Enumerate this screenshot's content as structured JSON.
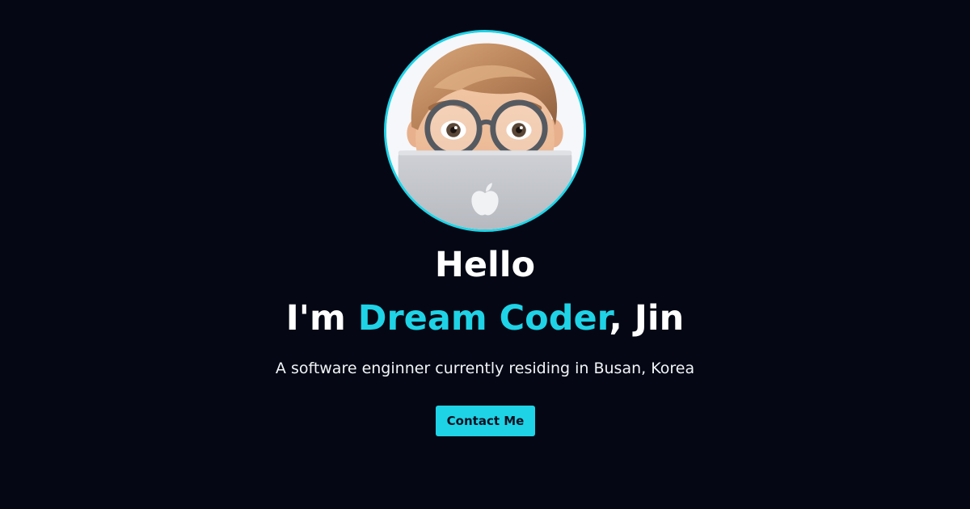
{
  "hero": {
    "avatar_alt": "memoji avatar with glasses behind laptop",
    "greeting": "Hello",
    "intro_prefix": "I'm ",
    "intro_name": "Dream Coder",
    "intro_suffix": ", Jin",
    "description": "A software enginner currently residing in Busan, Korea",
    "contact_label": "Contact Me"
  },
  "colors": {
    "background": "#050814",
    "accent": "#1fd3e6",
    "text": "#ffffff"
  }
}
